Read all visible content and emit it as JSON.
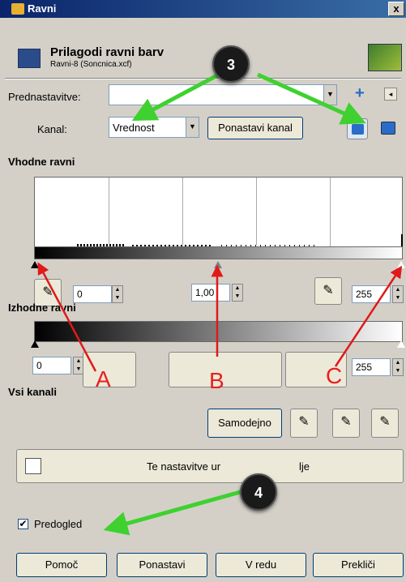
{
  "window": {
    "title": "Ravni",
    "close": "x"
  },
  "header": {
    "title": "Prilagodi ravni barv",
    "subtitle": "Ravni-8 (Soncnica.xcf)"
  },
  "presets": {
    "label": "Prednastavitve:",
    "value": ""
  },
  "channel": {
    "label": "Kanal:",
    "value": "Vrednost",
    "reset_button": "Ponastavi kanal"
  },
  "input_levels": {
    "heading": "Vhodne ravni",
    "low": "0",
    "gamma": "1,00",
    "high": "255"
  },
  "output_levels": {
    "heading": "Izhodne ravni",
    "low": "0",
    "high": "255"
  },
  "all_channels": {
    "heading": "Vsi kanali",
    "auto_button": "Samodejno"
  },
  "curves_button": {
    "left_text": "Te nastavitve ur",
    "right_text": "lje"
  },
  "preview": {
    "label": "Predogled",
    "checked": true,
    "mark": "✔"
  },
  "footer": {
    "help": "Pomoč",
    "reset": "Ponastavi",
    "ok": "V redu",
    "cancel": "Prekliči"
  },
  "callouts": {
    "c3": "3",
    "c4": "4"
  },
  "annotations": {
    "a": "A",
    "b": "B",
    "c": "C"
  },
  "colors": {
    "arrow_green": "#3fd12f",
    "arrow_red": "#e01a1a",
    "titlebar": "#0a246a"
  },
  "icons": {
    "plus": "+",
    "collapse": "◂",
    "dropdown": "▼",
    "spin_up": "▲",
    "spin_down": "▼",
    "picker": "✎"
  }
}
